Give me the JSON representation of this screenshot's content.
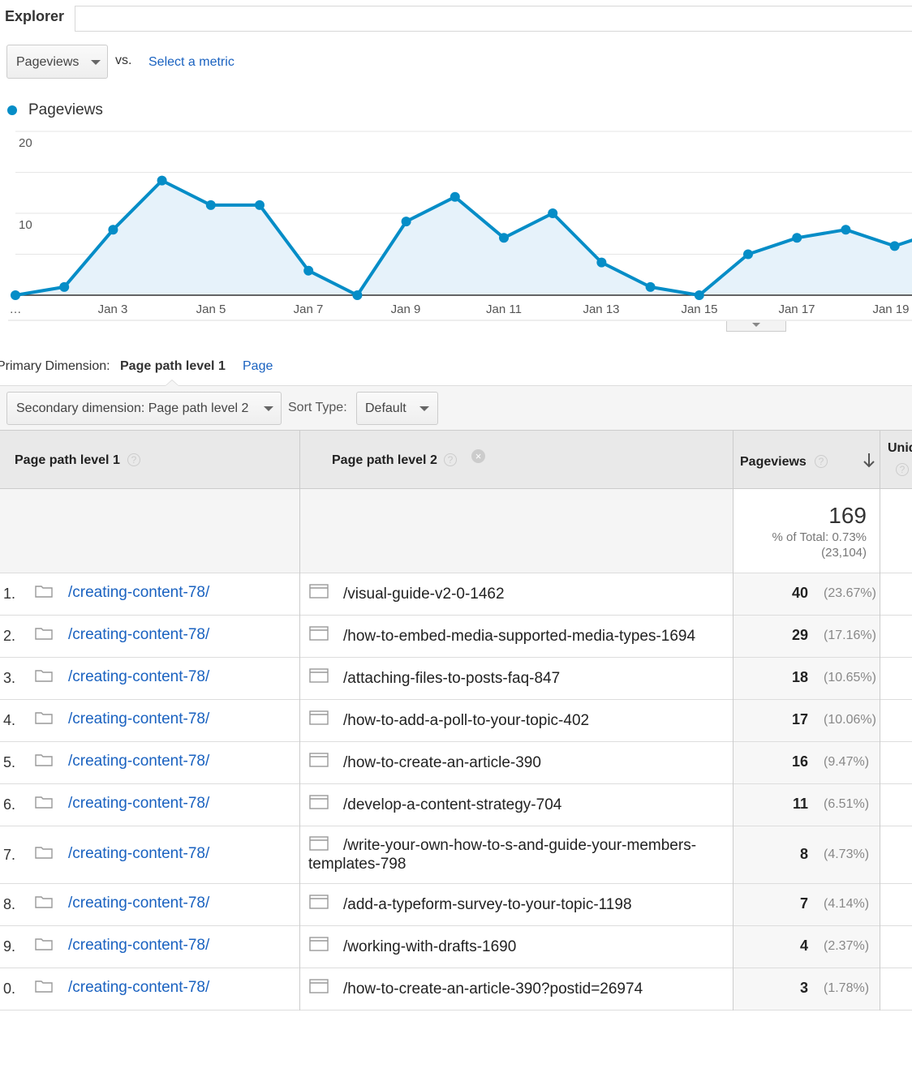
{
  "tabs": {
    "explorer": "Explorer"
  },
  "metric": {
    "primary": "Pageviews",
    "vs": "vs.",
    "select_metric": "Select a metric"
  },
  "legend": {
    "label": "Pageviews",
    "color": "#058dc7"
  },
  "chart_data": {
    "type": "area",
    "series": [
      {
        "name": "Pageviews",
        "values": [
          0,
          1,
          8,
          14,
          11,
          11,
          3,
          0,
          9,
          12,
          7,
          10,
          4,
          1,
          0,
          5,
          7,
          8,
          6,
          8
        ]
      }
    ],
    "x_tick_labels": [
      "…",
      "Jan 3",
      "Jan 5",
      "Jan 7",
      "Jan 9",
      "Jan 11",
      "Jan 13",
      "Jan 15",
      "Jan 17",
      "Jan 19"
    ],
    "y_tick_labels": [
      "20",
      "10"
    ],
    "ylim": [
      0,
      20
    ],
    "grid": true,
    "color": "#058dc7"
  },
  "primary_dimension": {
    "label": "Primary Dimension:",
    "current": "Page path level 1",
    "alt": "Page"
  },
  "toolbar": {
    "secondary": "Secondary dimension: Page path level 2",
    "sort_label": "Sort Type:",
    "sort_value": "Default"
  },
  "table": {
    "headers": {
      "col1": "Page path level 1",
      "col2": "Page path level 2",
      "col3": "Pageviews",
      "col4": "Uniq"
    },
    "total": {
      "value": "169",
      "pct": "% of Total: 0.73%",
      "of": "(23,104)"
    },
    "rows": [
      {
        "num": "1.",
        "p1": "/creating-content-78/",
        "p2": "/visual-guide-v2-0-1462",
        "pv": "40",
        "pct": "(23.67%)"
      },
      {
        "num": "2.",
        "p1": "/creating-content-78/",
        "p2": "/how-to-embed-media-supported-media-types-1694",
        "pv": "29",
        "pct": "(17.16%)"
      },
      {
        "num": "3.",
        "p1": "/creating-content-78/",
        "p2": "/attaching-files-to-posts-faq-847",
        "pv": "18",
        "pct": "(10.65%)"
      },
      {
        "num": "4.",
        "p1": "/creating-content-78/",
        "p2": "/how-to-add-a-poll-to-your-topic-402",
        "pv": "17",
        "pct": "(10.06%)"
      },
      {
        "num": "5.",
        "p1": "/creating-content-78/",
        "p2": "/how-to-create-an-article-390",
        "pv": "16",
        "pct": "(9.47%)"
      },
      {
        "num": "6.",
        "p1": "/creating-content-78/",
        "p2": "/develop-a-content-strategy-704",
        "pv": "11",
        "pct": "(6.51%)"
      },
      {
        "num": "7.",
        "p1": "/creating-content-78/",
        "p2": "/write-your-own-how-to-s-and-guide-your-members-templates-798",
        "pv": "8",
        "pct": "(4.73%)"
      },
      {
        "num": "8.",
        "p1": "/creating-content-78/",
        "p2": "/add-a-typeform-survey-to-your-topic-1198",
        "pv": "7",
        "pct": "(4.14%)"
      },
      {
        "num": "9.",
        "p1": "/creating-content-78/",
        "p2": "/working-with-drafts-1690",
        "pv": "4",
        "pct": "(2.37%)"
      },
      {
        "num": "0.",
        "p1": "/creating-content-78/",
        "p2": "/how-to-create-an-article-390?postid=26974",
        "pv": "3",
        "pct": "(1.78%)"
      }
    ]
  }
}
